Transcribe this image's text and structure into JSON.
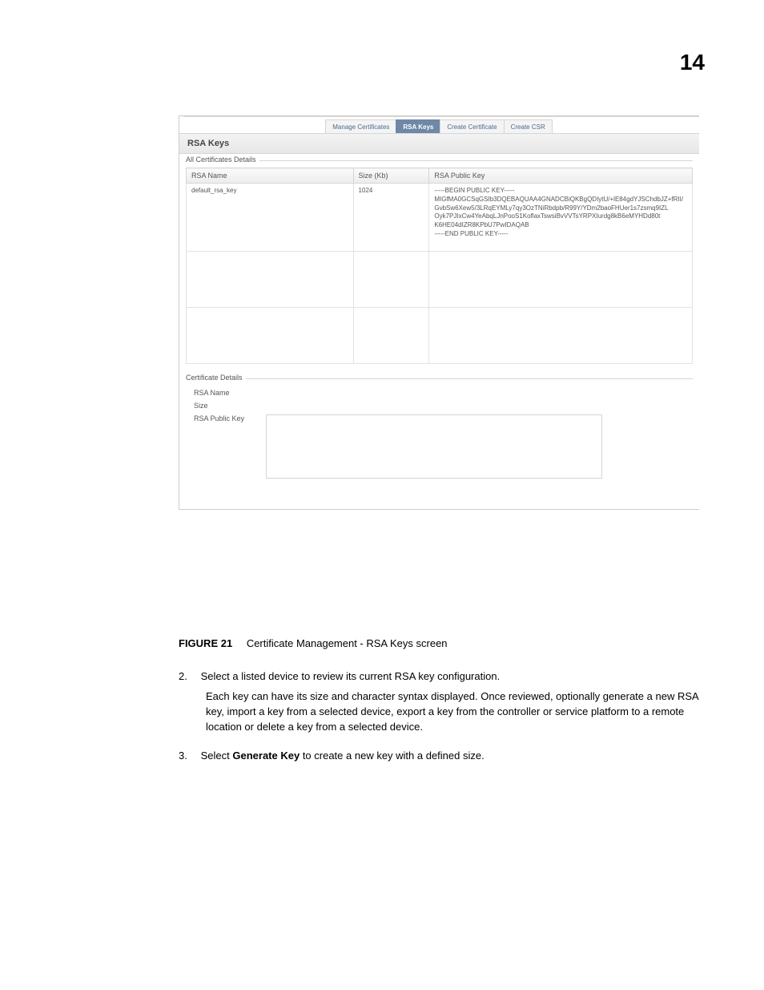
{
  "page_number": "14",
  "tabs": {
    "manage": "Manage Certificates",
    "rsa": "RSA Keys",
    "create_cert": "Create Certificate",
    "create_csr": "Create CSR"
  },
  "panel_title": "RSA Keys",
  "fieldset_all": "All Certificates Details",
  "columns": {
    "name": "RSA Name",
    "size": "Size (Kb)",
    "key": "RSA Public Key"
  },
  "row1": {
    "name": "default_rsa_key",
    "size": "1024",
    "key_l1": "-----BEGIN PUBLIC KEY-----",
    "key_l2": "MIGfMA0GCSqGSIb3DQEBAQUAA4GNADCBiQKBgQDIytU/+lE84gdYJSChdbJZ+fRII/",
    "key_l3": "GvbSw6Xew5/3LRqEYMLy7qy3OzTNiRbdpb/R99Y/YDm2baoFHUer1s7zsmq9IZL",
    "key_l4": "Oyk7PJIxCw4YeAbqLJnPooS1KoflaxTswsiBvVVTsYRPXIurdg8kB6eMYHDd80t",
    "key_l5": "K6HE04dIZR8KPbU7PwIDAQAB",
    "key_l6": "-----END PUBLIC KEY-----"
  },
  "details": {
    "legend": "Certificate Details",
    "rsa_name_label": "RSA Name",
    "size_label": "Size",
    "pubkey_label": "RSA Public Key"
  },
  "figure": {
    "label": "FIGURE 21",
    "caption": "Certificate Management - RSA Keys screen"
  },
  "step2_num": "2.",
  "step2_text": "Select a listed device to review its current RSA key configuration.",
  "step2_desc": "Each key can have its size and character syntax displayed. Once reviewed, optionally generate a new RSA key, import a key from a selected device, export a key from the controller or service platform to a remote location or delete a key from a selected device.",
  "step3_num": "3.",
  "step3_pre": "Select ",
  "step3_bold": "Generate Key",
  "step3_post": " to create a new key with a defined size."
}
